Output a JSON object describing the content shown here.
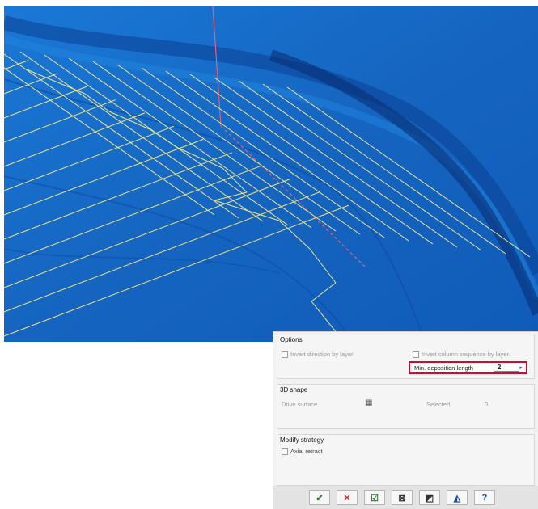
{
  "viewport": {
    "description_icons": [
      "toolpath-grid",
      "tool-axis-line"
    ],
    "colors": {
      "surface": "#1565c0",
      "grid": "#f0e68c",
      "axis": "#e0607a"
    }
  },
  "options": {
    "title": "Options",
    "invert_direction_label": "Invert direction by layer",
    "invert_column_label": "Invert column sequence by layer",
    "min_deposition_label": "Min. deposition length",
    "min_deposition_value": "2"
  },
  "shape3d": {
    "title": "3D shape",
    "drive_surface_label": "Drive surface",
    "selected_label": "Selected",
    "selected_count": "0"
  },
  "modify": {
    "title": "Modify strategy",
    "axial_retract_label": "Axial retract"
  },
  "buttons": [
    {
      "name": "ok-button",
      "icon": "check-icon",
      "glyph": "✔",
      "color": "#2e7d32"
    },
    {
      "name": "cancel-button",
      "icon": "x-icon",
      "glyph": "✕",
      "color": "#c62828"
    },
    {
      "name": "accept-preview-button",
      "icon": "preview-check-icon",
      "glyph": "☑",
      "color": "#2e7d32"
    },
    {
      "name": "reset-button",
      "icon": "reset-icon",
      "glyph": "⊠",
      "color": "#333"
    },
    {
      "name": "save-button",
      "icon": "save-icon",
      "glyph": "◩",
      "color": "#333"
    },
    {
      "name": "simulate-button",
      "icon": "simulate-icon",
      "glyph": "◭",
      "color": "#1b4fa0"
    },
    {
      "name": "help-button",
      "icon": "help-icon",
      "glyph": "?",
      "color": "#1b4fa0"
    }
  ]
}
